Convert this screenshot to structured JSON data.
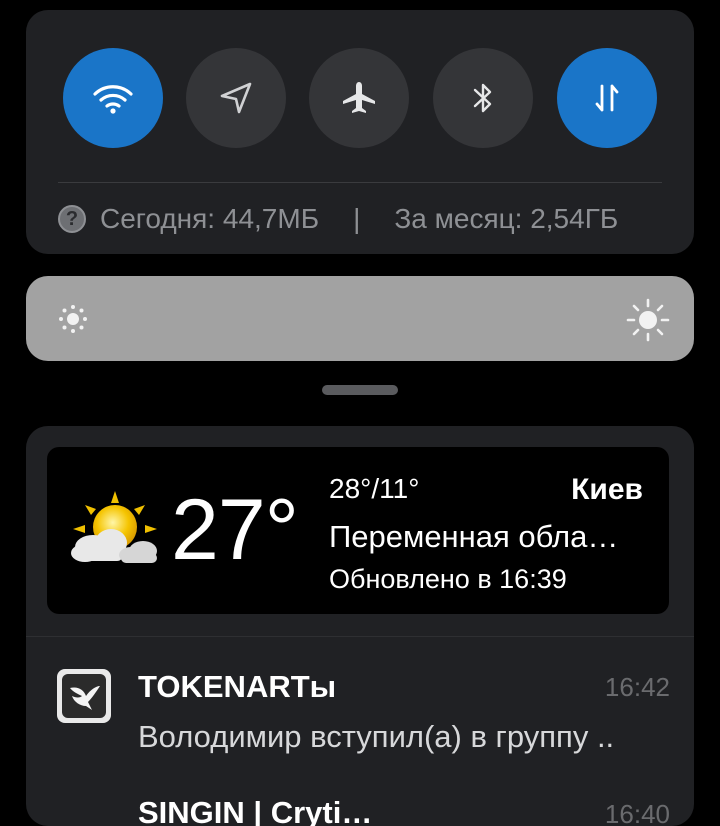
{
  "quick_settings": {
    "toggles": [
      {
        "name": "wifi",
        "icon": "wifi-icon",
        "active": true
      },
      {
        "name": "location",
        "icon": "location-arrow-icon",
        "active": false
      },
      {
        "name": "airplane",
        "icon": "airplane-icon",
        "active": false
      },
      {
        "name": "bluetooth",
        "icon": "bluetooth-icon",
        "active": false
      },
      {
        "name": "mobile-data",
        "icon": "data-transfer-icon",
        "active": true
      }
    ],
    "usage": {
      "today": "Сегодня: 44,7МБ",
      "separator": "|",
      "month": "За месяц: 2,54ГБ"
    },
    "active_color": "#1a75c8"
  },
  "brightness": {
    "low_icon": "brightness-low-icon",
    "high_icon": "brightness-high-icon"
  },
  "weather": {
    "icon": "partly-cloudy-icon",
    "temperature": "27°",
    "range": "28°/11°",
    "city": "Киев",
    "condition": "Переменная обла…",
    "updated": "Обновлено в 16:39"
  },
  "notifications": [
    {
      "app_icon": "tokenart-bird-icon",
      "title": "TOKENARTы",
      "time": "16:42",
      "body": "Володимир вступил(а) в группу .."
    },
    {
      "title": "SINGIN | Cryti…",
      "time": "16:40"
    }
  ]
}
